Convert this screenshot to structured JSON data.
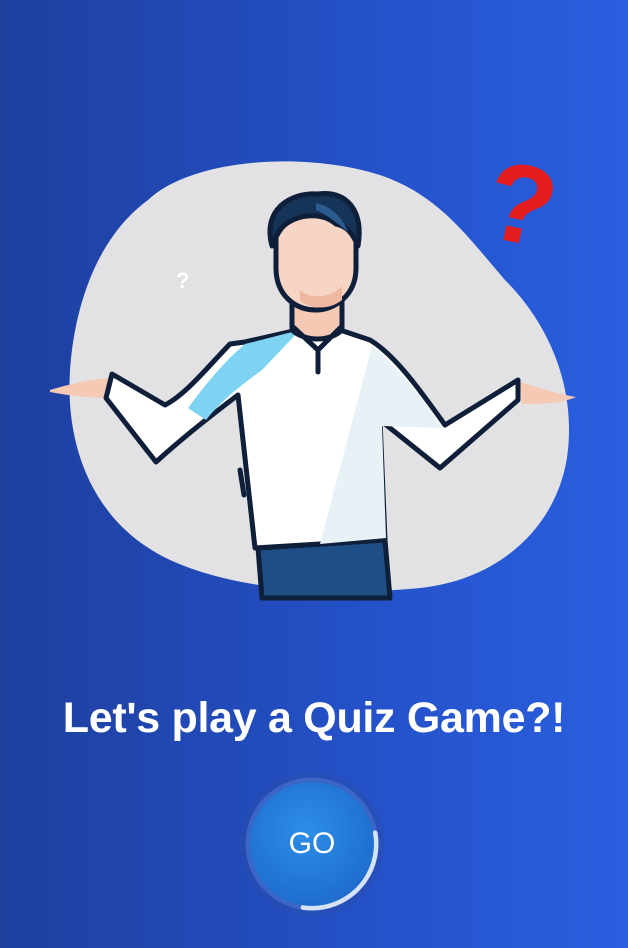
{
  "screen": {
    "headline": "Let's play a Quiz Game?!",
    "go_button_label": "GO"
  },
  "illustration": {
    "small_mark": "?",
    "big_mark": "?"
  },
  "colors": {
    "background_start": "#1e3f9e",
    "background_end": "#2a5fe0",
    "blob": "#e2e2e4",
    "question_mark": "#e31d1d",
    "button": "#1f6fd0",
    "ring_track": "#3a66c8",
    "ring_progress": "#d6e3f7"
  },
  "icons": [
    "confused-man-illustration",
    "question-mark-icon"
  ],
  "go_ring_progress": 0.3
}
